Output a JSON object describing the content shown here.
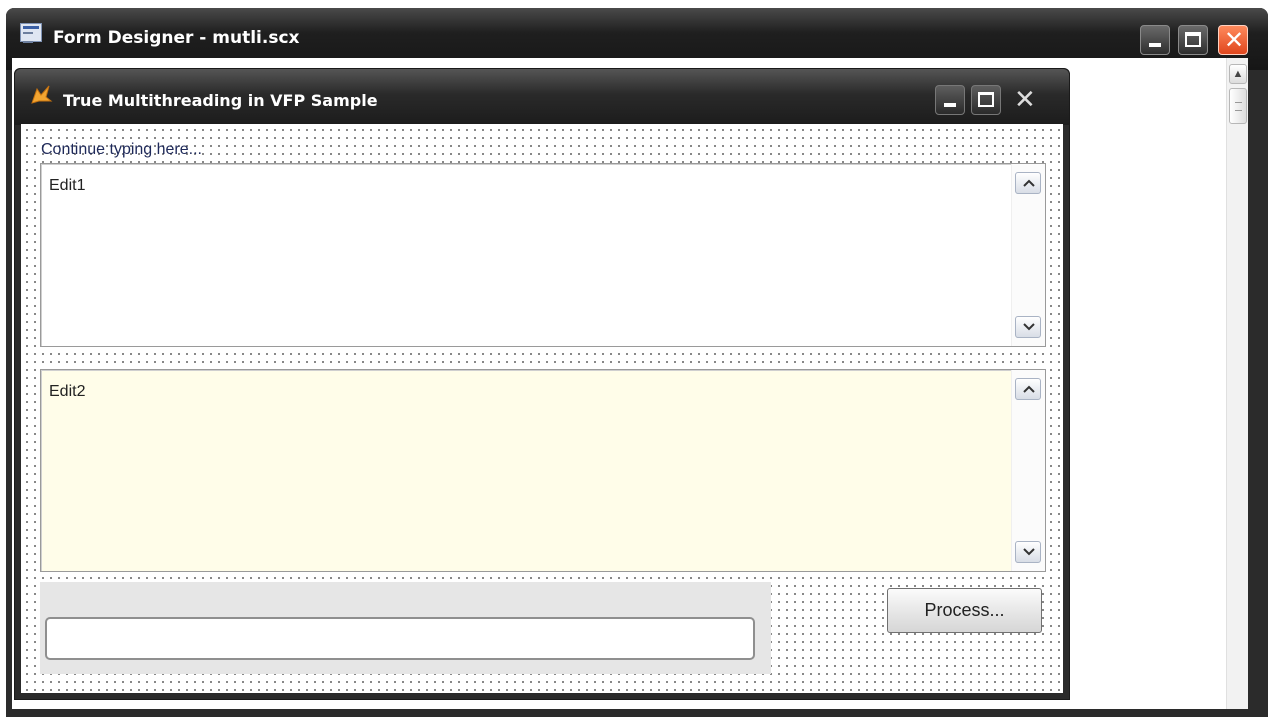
{
  "outer_window": {
    "title": "Form Designer - mutli.scx",
    "icons": {
      "app": "form-designer-icon",
      "minimize": "minimize-icon",
      "maximize": "maximize-icon",
      "close": "close-icon",
      "close_glyph": "✕"
    },
    "colors": {
      "titlebar": "#1f1f1f",
      "close_button": "#e0461d"
    }
  },
  "form_window": {
    "title": "True Multithreading in VFP Sample",
    "icons": {
      "app": "vfp-fox-icon",
      "minimize": "minimize-icon",
      "maximize": "maximize-icon",
      "close": "close-icon",
      "close_glyph": "✕"
    }
  },
  "form": {
    "label_continue": "Continue typing here...",
    "edit1": {
      "value": "Edit1",
      "background": "#ffffff"
    },
    "edit2": {
      "value": "Edit2",
      "background": "#fffde9"
    },
    "textbox": {
      "value": ""
    },
    "process_button": "Process..."
  },
  "scroll": {
    "up_glyph": "▲"
  }
}
